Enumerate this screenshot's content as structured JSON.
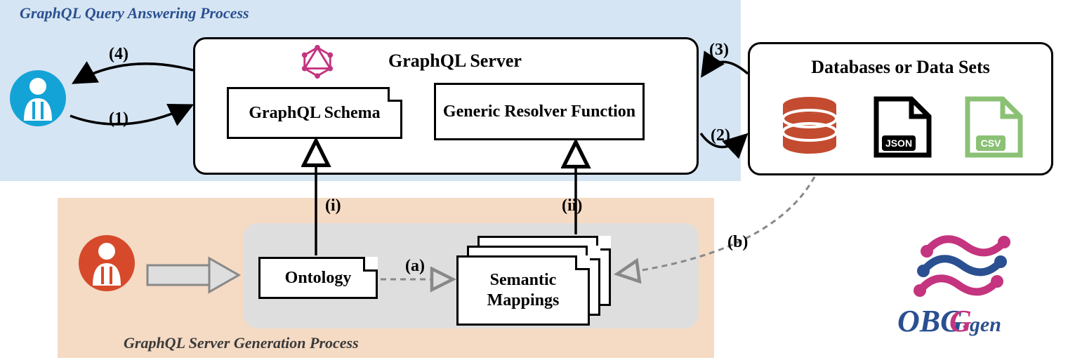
{
  "diagram": {
    "top_process_label": "GraphQL Query Answering Process",
    "bottom_process_label": "GraphQL Server Generation Process",
    "server": {
      "title": "GraphQL Server",
      "schema_box": "GraphQL Schema",
      "resolver_box": "Generic Resolver Function"
    },
    "databases": {
      "title": "Databases or Data Sets",
      "json_badge": "JSON",
      "csv_badge": "CSV"
    },
    "inputs": {
      "ontology": "Ontology",
      "mappings": "Semantic Mappings"
    },
    "edges": {
      "e1": "(1)",
      "e2": "(2)",
      "e3": "(3)",
      "e4": "(4)",
      "ei": "(i)",
      "eii": "(ii)",
      "ea": "(a)",
      "eb": "(b)"
    },
    "logo": {
      "text_obg": "OBG",
      "text_gen": "-gen"
    }
  }
}
